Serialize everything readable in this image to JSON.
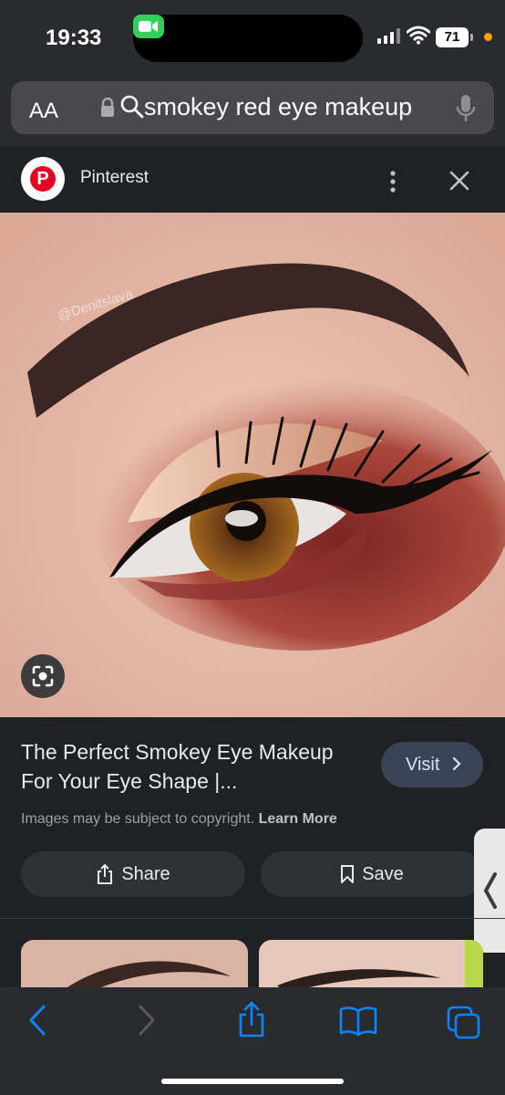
{
  "status": {
    "time": "19:33",
    "battery": "71",
    "icons": [
      "facetime-camera-icon",
      "signal-bars-icon",
      "wifi-icon",
      "battery-icon",
      "privacy-dot-icon"
    ]
  },
  "browser": {
    "text_size_label": "AA",
    "search_query": "smokey red eye makeup",
    "icons": [
      "lock-icon",
      "search-icon",
      "microphone-icon"
    ]
  },
  "source": {
    "name": "Pinterest",
    "icons": [
      "pinterest-logo-icon",
      "more-vertical-icon",
      "close-icon"
    ]
  },
  "image": {
    "watermark": "@Denitslava"
  },
  "result": {
    "title": "The Perfect Smokey Eye Makeup For Your Eye Shape |...",
    "visit_label": "Visit",
    "copyright_text": "Images may be subject to copyright.",
    "learn_more": "Learn More",
    "share_label": "Share",
    "save_label": "Save"
  },
  "toolbar": {
    "icons": [
      "back-icon",
      "forward-icon",
      "share-icon",
      "bookmarks-icon",
      "tabs-icon"
    ]
  },
  "colors": {
    "accent": "#0a84ff",
    "pinterest_red": "#e60023",
    "facetime_green": "#30d158"
  }
}
